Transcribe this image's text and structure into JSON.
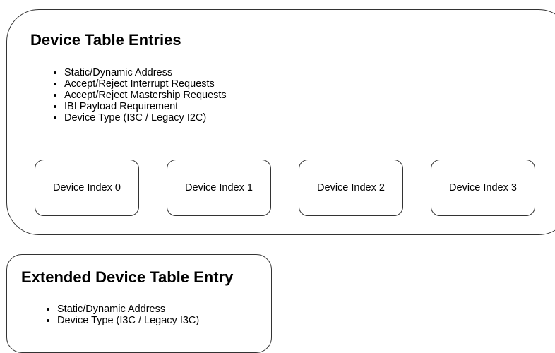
{
  "device_table": {
    "title": "Device Table Entries",
    "bullets": [
      "Static/Dynamic Address",
      "Accept/Reject Interrupt Requests",
      "Accept/Reject Mastership Requests",
      "IBI Payload Requirement",
      "Device Type (I3C / Legacy I2C)"
    ],
    "devices": [
      "Device Index 0",
      "Device Index 1",
      "Device Index 2",
      "Device Index 3"
    ]
  },
  "extended_table": {
    "title": "Extended Device Table Entry",
    "bullets": [
      "Static/Dynamic Address",
      "Device Type (I3C / Legacy I3C)"
    ]
  },
  "colors": {
    "border": "#333333",
    "background": "#ffffff",
    "text": "#000000"
  }
}
